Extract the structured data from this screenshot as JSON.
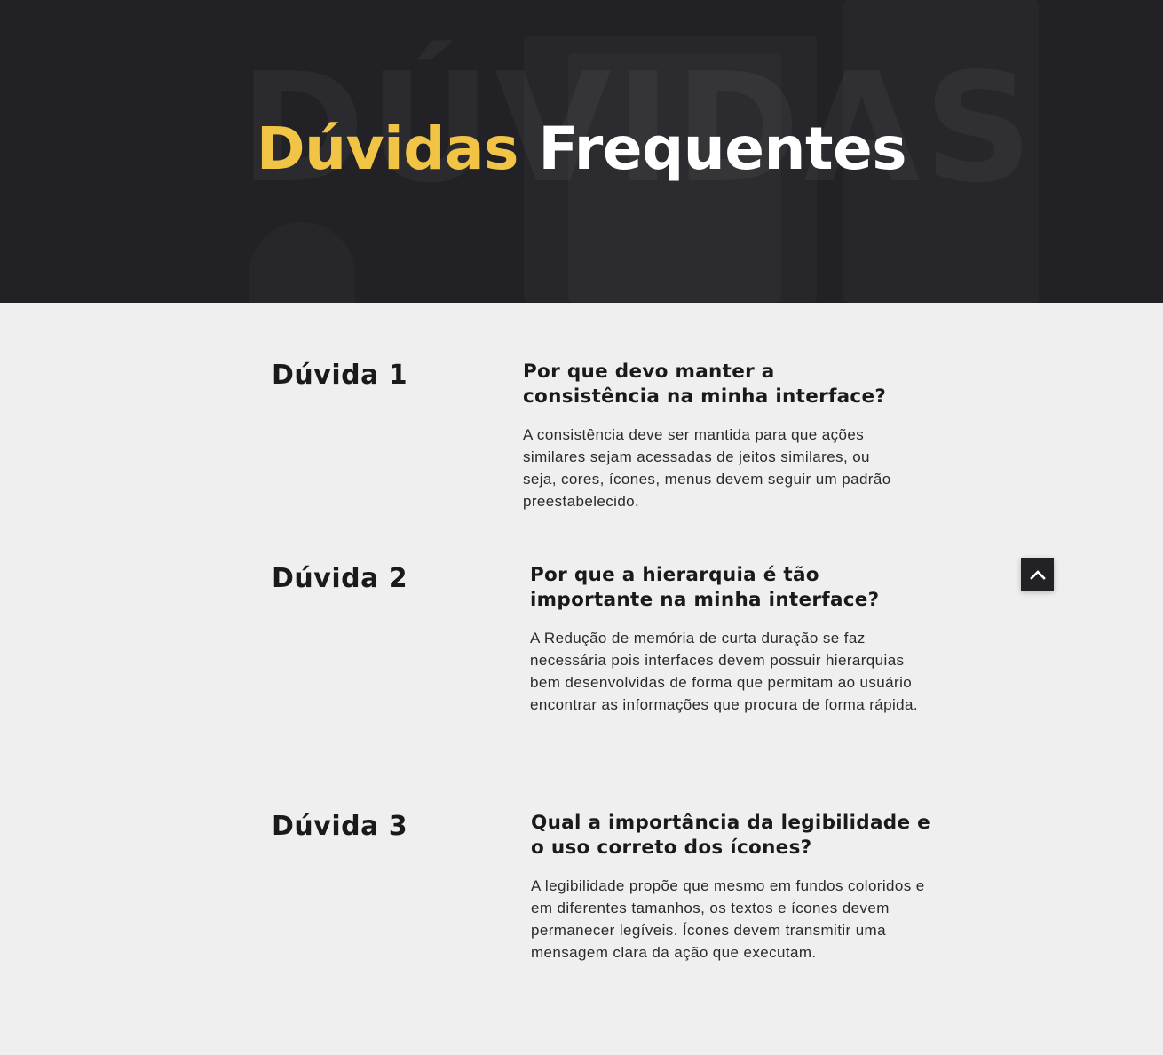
{
  "hero": {
    "title_accent": "Dúvidas",
    "title_rest": "Frequentes",
    "background_word": "DÚVIDAS",
    "accent_color": "#f1c445",
    "background_color": "#222125"
  },
  "faq": [
    {
      "label": "Dúvida 1",
      "question": "Por que devo manter a consistência na minha interface?",
      "answer": "A consistência deve ser mantida para que ações similares sejam acessadas de jeitos similares, ou seja, cores, ícones, menus devem seguir um padrão preestabelecido."
    },
    {
      "label": "Dúvida 2",
      "question": "Por que a hierarquia é tão importante na minha interface?",
      "answer": "A Redução de memória de curta duração se faz necessária pois interfaces devem possuir hierarquias bem desenvolvidas de forma que permitam ao usuário encontrar as informações que procura de forma rápida."
    },
    {
      "label": "Dúvida 3",
      "question": "Qual a importância da legibilidade e o uso correto dos ícones?",
      "answer": "A legibilidade propõe que mesmo em fundos coloridos e em diferentes tamanhos, os textos e ícones devem permanecer legíveis. Ícones devem transmitir uma mensagem clara da ação que executam."
    }
  ],
  "back_to_top": {
    "icon": "chevron-up-icon"
  }
}
